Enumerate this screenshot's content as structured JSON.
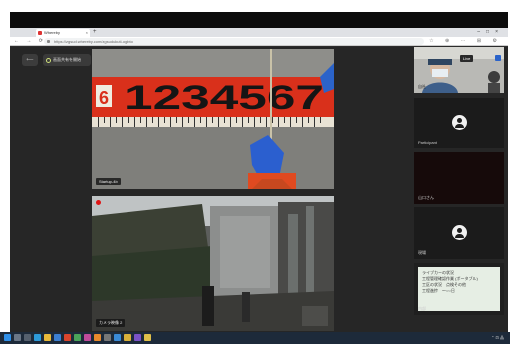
{
  "browser": {
    "tab_title": "Whereby",
    "tab_close": "×",
    "new_tab": "+",
    "window_controls": "–□×",
    "nav_icons": "← → ⟳",
    "url": "https://zgsud.whereby.com/zgsudukuti-ogbto",
    "extension_icons": "☆ ⊕ ⋯ ⊞ ⚙"
  },
  "toolbar": {
    "leave_label": "⟵",
    "share_label": "画面共有を開始"
  },
  "main_tiles": [
    {
      "name": "Startup-4b",
      "tape_digits": "1234567",
      "tape_prefix": "6"
    },
    {
      "name": "カメラ映像 2"
    }
  ],
  "sidebar": {
    "tiles": [
      {
        "label": "自社",
        "badge": "Live"
      },
      {
        "label": "Participant"
      },
      {
        "label": "山口さん"
      },
      {
        "label": "現場"
      },
      {
        "label": "内部"
      }
    ],
    "chat_lines": [
      "ライブカーの状況",
      "工程管理確認作業 (ポータブル)",
      "工区の状況　点検その他",
      "工程進捗　〜○○日"
    ]
  },
  "colors": {
    "app_bg": "#262626",
    "tape_red": "#d9301b",
    "record_red": "#e01414",
    "chat_bg": "#e6eee4"
  },
  "icons": [
    "lock-icon",
    "avatar-icon",
    "record-icon",
    "share-screen-icon",
    "mic-off-icon"
  ]
}
